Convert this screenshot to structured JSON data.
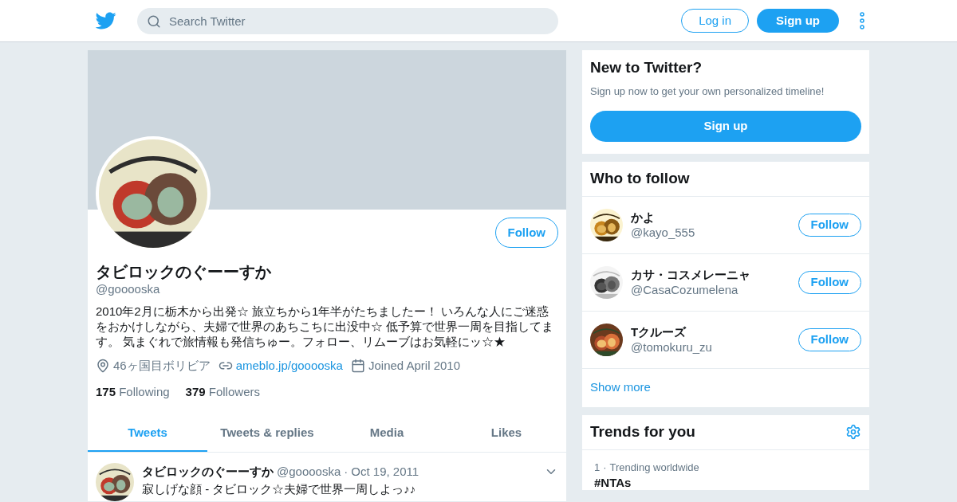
{
  "header": {
    "search_placeholder": "Search Twitter",
    "login": "Log in",
    "signup": "Sign up"
  },
  "profile": {
    "name": "タビロックのぐーーすか",
    "handle": "@gooooska",
    "bio": "2010年2月に栃木から出発☆ 旅立ちから1年半がたちましたー！ いろんな人にご迷惑をおかけしながら、夫婦で世界のあちこちに出没中☆ 低予算で世界一周を目指してます。 気まぐれで旅情報も発信ちゅー。フォロー、リムーブはお気軽にッ☆★",
    "location": "46ヶ国目ボリビア",
    "website": "ameblo.jp/gooooska",
    "joined": "Joined April 2010",
    "follow_button": "Follow",
    "stats": [
      {
        "count": "175",
        "label": "Following"
      },
      {
        "count": "379",
        "label": "Followers"
      }
    ]
  },
  "tabs": [
    {
      "label": "Tweets",
      "selected": true
    },
    {
      "label": "Tweets & replies",
      "selected": false
    },
    {
      "label": "Media",
      "selected": false
    },
    {
      "label": "Likes",
      "selected": false
    }
  ],
  "tweets": [
    {
      "name": "タビロックのぐーーすか",
      "handle": "@gooooska",
      "separator": "·",
      "date": "Oct 19, 2011",
      "text": "寂しげな顔 - タビロック☆夫婦で世界一周しよっ♪♪"
    }
  ],
  "new_to_twitter": {
    "title": "New to Twitter?",
    "subtitle": "Sign up now to get your own personalized timeline!",
    "button": "Sign up"
  },
  "who_to_follow": {
    "title": "Who to follow",
    "accounts": [
      {
        "name": "かよ",
        "handle": "@kayo_555",
        "button": "Follow"
      },
      {
        "name": "カサ・コスメレーニャ",
        "handle": "@CasaCozumelena",
        "button": "Follow"
      },
      {
        "name": "Tクルーズ",
        "handle": "@tomokuru_zu",
        "button": "Follow"
      }
    ],
    "show_more": "Show more"
  },
  "trends": {
    "title": "Trends for you",
    "items": [
      {
        "rank": "1",
        "separator": "·",
        "context": "Trending worldwide",
        "tag": "#NTAs"
      }
    ]
  }
}
